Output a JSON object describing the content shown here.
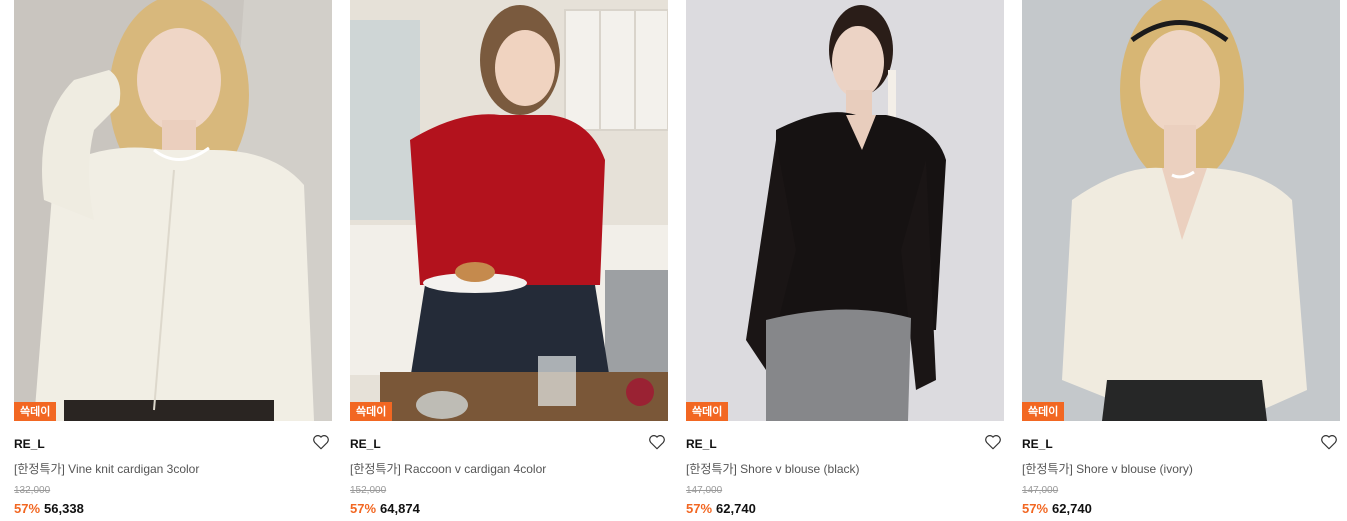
{
  "products": [
    {
      "badge": "쓱데이",
      "brand": "RE_L",
      "name": "[한정특가] Vine knit cardigan 3color",
      "original_price": "132,000",
      "discount": "57%",
      "price": "56,338",
      "bg": "#c7c3bd",
      "garment": "#f1eee4"
    },
    {
      "badge": "쓱데이",
      "brand": "RE_L",
      "name": "[한정특가] Raccoon v cardigan 4color",
      "original_price": "152,000",
      "discount": "57%",
      "price": "64,874",
      "bg": "#e7e2d9",
      "garment": "#b3121d"
    },
    {
      "badge": "쓱데이",
      "brand": "RE_L",
      "name": "[한정특가] Shore v blouse (black)",
      "original_price": "147,000",
      "discount": "57%",
      "price": "62,740",
      "bg": "#dad9dd",
      "garment": "#161212"
    },
    {
      "badge": "쓱데이",
      "brand": "RE_L",
      "name": "[한정특가] Shore v blouse (ivory)",
      "original_price": "147,000",
      "discount": "57%",
      "price": "62,740",
      "bg": "#c5c9cc",
      "garment": "#f0ebdf"
    }
  ]
}
